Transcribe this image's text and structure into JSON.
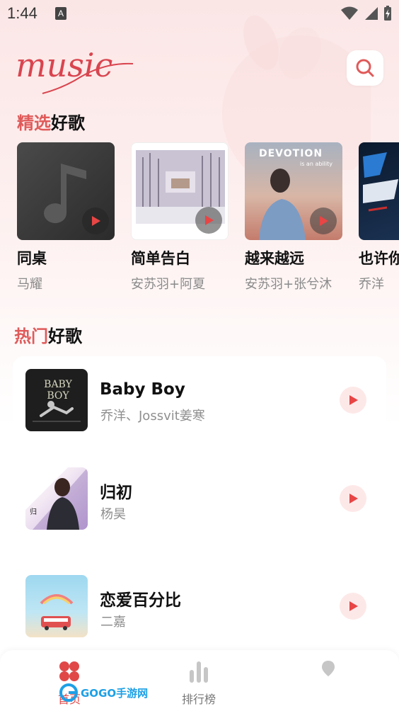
{
  "status_bar": {
    "time": "1:44",
    "notif_letter": "A"
  },
  "header": {
    "logo_text": "music"
  },
  "featured": {
    "title_accent": "精选",
    "title_rest": "好歌",
    "items": [
      {
        "title": "同桌",
        "artist": "马耀"
      },
      {
        "title": "简单告白",
        "artist": "安苏羽+阿夏"
      },
      {
        "title": "越来越远",
        "artist": "安苏羽+张兮沐",
        "cover_text": "DEVOTION",
        "cover_sub": "is an ability"
      },
      {
        "title": "也许你",
        "artist": "乔洋"
      }
    ]
  },
  "hot": {
    "title_accent": "热门",
    "title_rest": "好歌",
    "items": [
      {
        "title": "Baby Boy",
        "artist": "乔洋、Jossvit姜寒",
        "cover_text": "BABY BOY"
      },
      {
        "title": "归初",
        "artist": "杨昊"
      },
      {
        "title": "恋爱百分比",
        "artist": "二嘉"
      }
    ]
  },
  "nav": {
    "home_label": "首页",
    "rank_label": "排行榜",
    "me_label": ""
  },
  "watermark": {
    "text": "GOGO手游网"
  },
  "colors": {
    "accent": "#e05a5a",
    "play_bg": "#fde8e8"
  }
}
